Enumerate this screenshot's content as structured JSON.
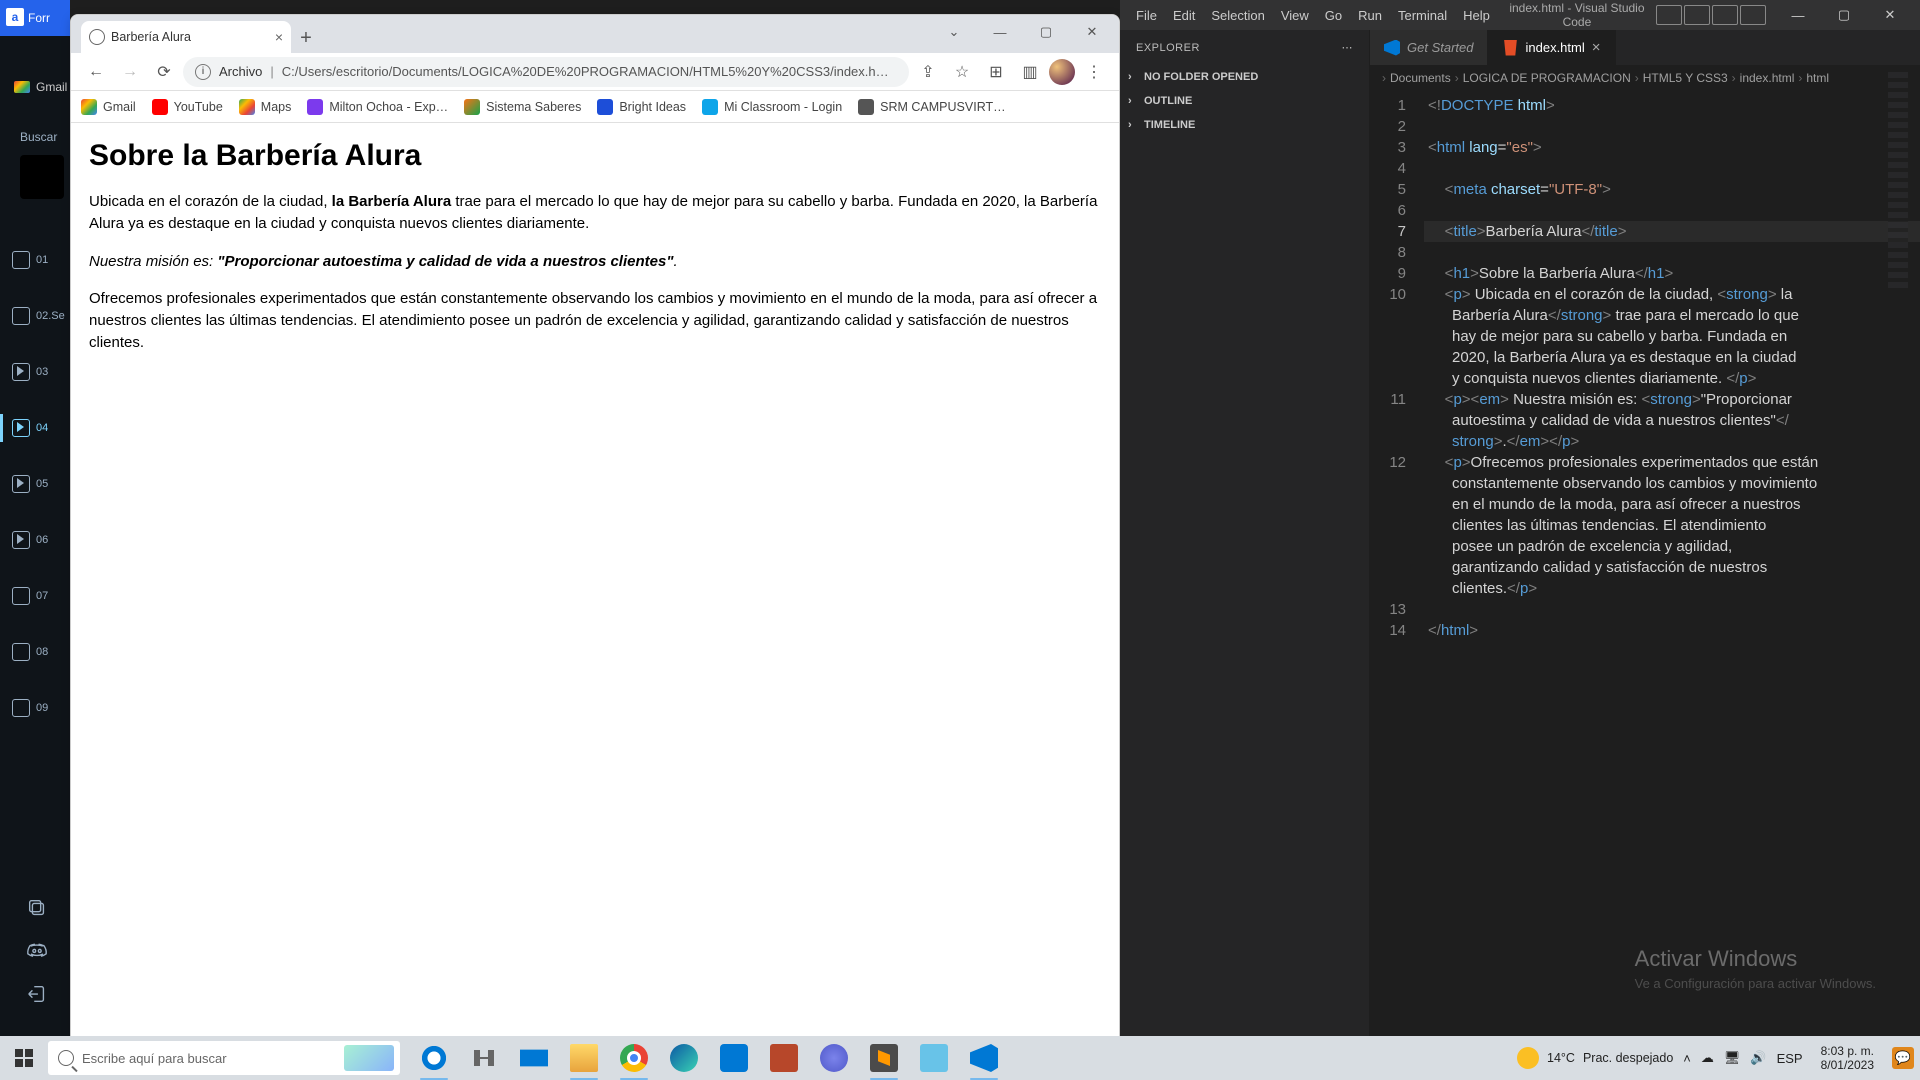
{
  "left_sliver": {
    "logo_text": "Forr",
    "fav_label": "Gmail",
    "search_label": "Buscar",
    "items": [
      "01",
      "02.Se",
      "03",
      "04",
      "05",
      "06",
      "07",
      "08",
      "09"
    ],
    "active_index": 3
  },
  "chrome": {
    "tab_title": "Barbería Alura",
    "url_prefix": "Archivo",
    "url": "C:/Users/escritorio/Documents/LOGICA%20DE%20PROGRAMACION/HTML5%20Y%20CSS3/index.h…",
    "bookmarks": [
      {
        "label": "Gmail",
        "color": "linear-gradient(135deg,#ea4335,#fbbc04,#34a853,#4285f4)"
      },
      {
        "label": "YouTube",
        "color": "#ff0000"
      },
      {
        "label": "Maps",
        "color": "linear-gradient(135deg,#34a853,#fbbc04,#ea4335,#4285f4)"
      },
      {
        "label": "Milton Ochoa - Exp…",
        "color": "#7c3aed"
      },
      {
        "label": "Sistema Saberes",
        "color": "linear-gradient(135deg,#f97316,#16a34a)"
      },
      {
        "label": "Bright Ideas",
        "color": "#1d4ed8"
      },
      {
        "label": "Mi Classroom - Login",
        "color": "#0ea5e9"
      },
      {
        "label": "SRM CAMPUSVIRT…",
        "color": "#555"
      }
    ],
    "page": {
      "h1": "Sobre la Barbería Alura",
      "p1_a": "Ubicada en el corazón de la ciudad, ",
      "p1_strong": "la Barbería Alura",
      "p1_b": " trae para el mercado lo que hay de mejor para su cabello y barba. Fundada en 2020, la Barbería Alura ya es destaque en la ciudad y conquista nuevos clientes diariamente.",
      "p2_a": "Nuestra misión es: ",
      "p2_strong": "\"Proporcionar autoestima y calidad de vida a nuestros clientes\"",
      "p2_b": ".",
      "p3": "Ofrecemos profesionales experimentados que están constantemente observando los cambios y movimiento en el mundo de la moda, para así ofrecer a nuestros clientes las últimas tendencias. El atendimiento posee un padrón de excelencia y agilidad, garantizando calidad y satisfacción de nuestros clientes."
    }
  },
  "vscode": {
    "menus": [
      "File",
      "Edit",
      "Selection",
      "View",
      "Go",
      "Run",
      "Terminal",
      "Help"
    ],
    "title": "index.html - Visual Studio Code",
    "explorer_label": "EXPLORER",
    "sections": [
      "NO FOLDER OPENED",
      "OUTLINE",
      "TIMELINE"
    ],
    "tabs": [
      {
        "label": "Get Started",
        "active": false
      },
      {
        "label": "index.html",
        "active": true
      }
    ],
    "breadcrumbs": [
      "Documents",
      "LOGICA DE PROGRAMACION",
      "HTML5 Y CSS3",
      "index.html",
      "html"
    ],
    "watermark_title": "Activar Windows",
    "watermark_sub": "Ve a Configuración para activar Windows.",
    "code_lines": [
      {
        "n": 1,
        "html": "<span class='c-ang'>&lt;!</span><span class='c-doc'>DOCTYPE</span> <span class='c-attr'>html</span><span class='c-ang'>&gt;</span>"
      },
      {
        "n": 2,
        "html": ""
      },
      {
        "n": 3,
        "html": "<span class='c-ang'>&lt;</span><span class='c-tag'>html</span> <span class='c-attr'>lang</span>=<span class='c-str'>\"es\"</span><span class='c-ang'>&gt;</span>"
      },
      {
        "n": 4,
        "html": ""
      },
      {
        "n": 5,
        "html": "    <span class='c-ang'>&lt;</span><span class='c-tag'>meta</span> <span class='c-attr'>charset</span>=<span class='c-str'>\"UTF-8\"</span><span class='c-ang'>&gt;</span>"
      },
      {
        "n": 6,
        "html": ""
      },
      {
        "n": 7,
        "hl": true,
        "html": "    <span class='c-ang'>&lt;</span><span class='c-tag'>title</span><span class='c-ang'>&gt;</span>Barbería Alura<span class='c-ang'>&lt;/</span><span class='c-tag'>title</span><span class='c-ang'>&gt;</span>"
      },
      {
        "n": 8,
        "html": ""
      },
      {
        "n": 9,
        "html": "    <span class='c-ang'>&lt;</span><span class='c-tag'>h1</span><span class='c-ang'>&gt;</span>Sobre la Barbería Alura<span class='c-ang'>&lt;/</span><span class='c-tag'>h1</span><span class='c-ang'>&gt;</span>"
      },
      {
        "n": 10,
        "html": "    <span class='c-ang'>&lt;</span><span class='c-tag'>p</span><span class='c-ang'>&gt;</span> Ubicada en el corazón de la ciudad, <span class='c-ang'>&lt;</span><span class='c-tag'>strong</span><span class='c-ang'>&gt;</span> la"
      },
      {
        "wrap": true,
        "html": "Barbería Alura<span class='c-ang'>&lt;/</span><span class='c-tag'>strong</span><span class='c-ang'>&gt;</span> trae para el mercado lo que"
      },
      {
        "wrap": true,
        "html": "hay de mejor para su cabello y barba. Fundada en"
      },
      {
        "wrap": true,
        "html": "2020, la Barbería Alura ya es destaque en la ciudad"
      },
      {
        "wrap": true,
        "html": "y conquista nuevos clientes diariamente. <span class='c-ang'>&lt;/</span><span class='c-tag'>p</span><span class='c-ang'>&gt;</span>"
      },
      {
        "n": 11,
        "html": "    <span class='c-ang'>&lt;</span><span class='c-tag'>p</span><span class='c-ang'>&gt;&lt;</span><span class='c-tag'>em</span><span class='c-ang'>&gt;</span> Nuestra misión es: <span class='c-ang'>&lt;</span><span class='c-tag'>strong</span><span class='c-ang'>&gt;</span>\"Proporcionar"
      },
      {
        "wrap": true,
        "html": "autoestima y calidad de vida a nuestros clientes\"<span class='c-ang'>&lt;/</span>"
      },
      {
        "wrap": true,
        "html": "<span class='c-tag'>strong</span><span class='c-ang'>&gt;</span>.<span class='c-ang'>&lt;/</span><span class='c-tag'>em</span><span class='c-ang'>&gt;&lt;/</span><span class='c-tag'>p</span><span class='c-ang'>&gt;</span>"
      },
      {
        "n": 12,
        "html": "    <span class='c-ang'>&lt;</span><span class='c-tag'>p</span><span class='c-ang'>&gt;</span>Ofrecemos profesionales experimentados que están"
      },
      {
        "wrap": true,
        "html": "constantemente observando los cambios y movimiento"
      },
      {
        "wrap": true,
        "html": "en el mundo de la moda, para así ofrecer a nuestros"
      },
      {
        "wrap": true,
        "html": "clientes las últimas tendencias. El atendimiento"
      },
      {
        "wrap": true,
        "html": "posee un padrón de excelencia y agilidad,"
      },
      {
        "wrap": true,
        "html": "garantizando calidad y satisfacción de nuestros"
      },
      {
        "wrap": true,
        "html": "clientes.<span class='c-ang'>&lt;/</span><span class='c-tag'>p</span><span class='c-ang'>&gt;</span>"
      },
      {
        "n": 13,
        "html": ""
      },
      {
        "n": 14,
        "html": "<span class='c-ang'>&lt;/</span><span class='c-tag'>html</span><span class='c-ang'>&gt;</span>"
      }
    ]
  },
  "taskbar": {
    "search_placeholder": "Escribe aquí para buscar",
    "weather_temp": "14°C",
    "weather_text": "Prac. despejado",
    "lang": "ESP",
    "time": "8:03 p. m.",
    "date": "8/01/2023"
  }
}
